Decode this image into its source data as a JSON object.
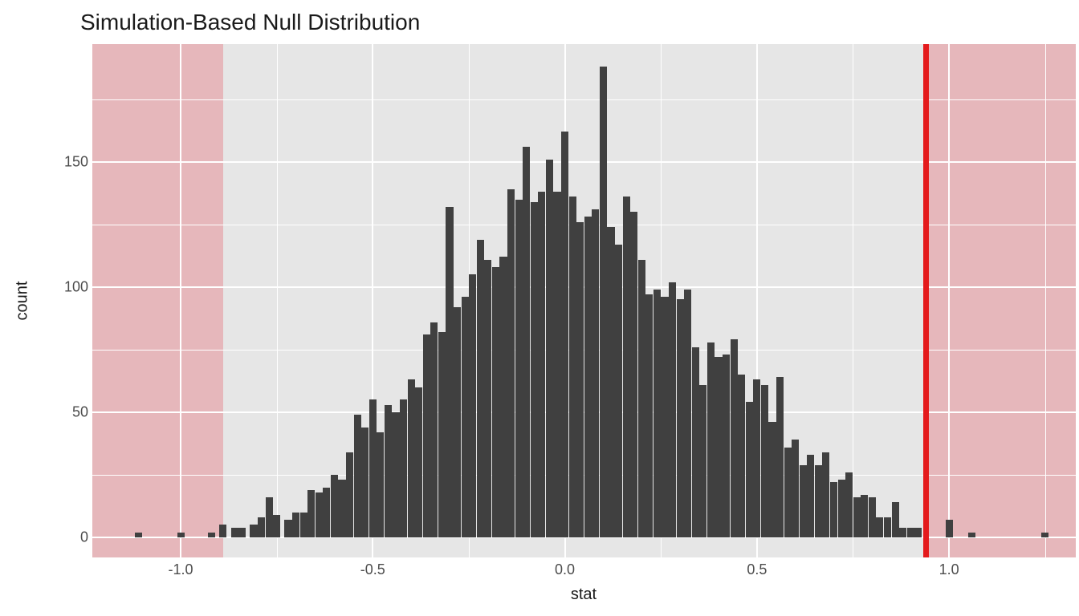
{
  "chart_data": {
    "type": "bar",
    "title": "Simulation-Based Null Distribution",
    "xlabel": "stat",
    "ylabel": "count",
    "xlim": [
      -1.23,
      1.33
    ],
    "ylim": [
      -8,
      197
    ],
    "x_ticks": [
      -1.0,
      -0.5,
      0.0,
      0.5,
      1.0
    ],
    "y_ticks": [
      0,
      50,
      100,
      150
    ],
    "x_ticks_minor": [
      -0.75,
      -0.25,
      0.25,
      0.75,
      1.25
    ],
    "y_ticks_minor": [
      25,
      75,
      125,
      175
    ],
    "shade_left": [
      -1.23,
      -0.89
    ],
    "shade_right": [
      0.94,
      1.33
    ],
    "vline": 0.94,
    "bar_width": 0.019,
    "bars": {
      "x": [
        -1.11,
        -1.0,
        -0.92,
        -0.89,
        -0.86,
        -0.84,
        -0.81,
        -0.79,
        -0.77,
        -0.75,
        -0.72,
        -0.7,
        -0.68,
        -0.66,
        -0.64,
        -0.62,
        -0.6,
        -0.58,
        -0.56,
        -0.54,
        -0.52,
        -0.5,
        -0.48,
        -0.46,
        -0.44,
        -0.42,
        -0.4,
        -0.38,
        -0.36,
        -0.34,
        -0.32,
        -0.3,
        -0.28,
        -0.26,
        -0.24,
        -0.22,
        -0.2,
        -0.18,
        -0.16,
        -0.14,
        -0.12,
        -0.1,
        -0.08,
        -0.06,
        -0.04,
        -0.02,
        0.0,
        0.02,
        0.04,
        0.06,
        0.08,
        0.1,
        0.12,
        0.14,
        0.16,
        0.18,
        0.2,
        0.22,
        0.24,
        0.26,
        0.28,
        0.3,
        0.32,
        0.34,
        0.36,
        0.38,
        0.4,
        0.42,
        0.44,
        0.46,
        0.48,
        0.5,
        0.52,
        0.54,
        0.56,
        0.58,
        0.6,
        0.62,
        0.64,
        0.66,
        0.68,
        0.7,
        0.72,
        0.74,
        0.76,
        0.78,
        0.8,
        0.82,
        0.84,
        0.86,
        0.88,
        0.9,
        0.92,
        1.0,
        1.06,
        1.25
      ],
      "count": [
        2,
        2,
        2,
        5,
        4,
        4,
        5,
        8,
        16,
        9,
        7,
        10,
        10,
        19,
        18,
        20,
        25,
        23,
        34,
        49,
        44,
        55,
        42,
        53,
        50,
        55,
        63,
        60,
        81,
        86,
        82,
        132,
        92,
        96,
        105,
        119,
        111,
        108,
        112,
        139,
        135,
        156,
        134,
        138,
        151,
        138,
        162,
        136,
        126,
        128,
        131,
        188,
        124,
        117,
        136,
        130,
        111,
        97,
        99,
        96,
        102,
        95,
        99,
        76,
        61,
        78,
        72,
        73,
        79,
        65,
        54,
        63,
        61,
        46,
        64,
        36,
        39,
        29,
        33,
        29,
        34,
        22,
        23,
        26,
        16,
        17,
        16,
        8,
        8,
        14,
        4,
        4,
        4,
        7,
        2,
        2
      ]
    }
  }
}
